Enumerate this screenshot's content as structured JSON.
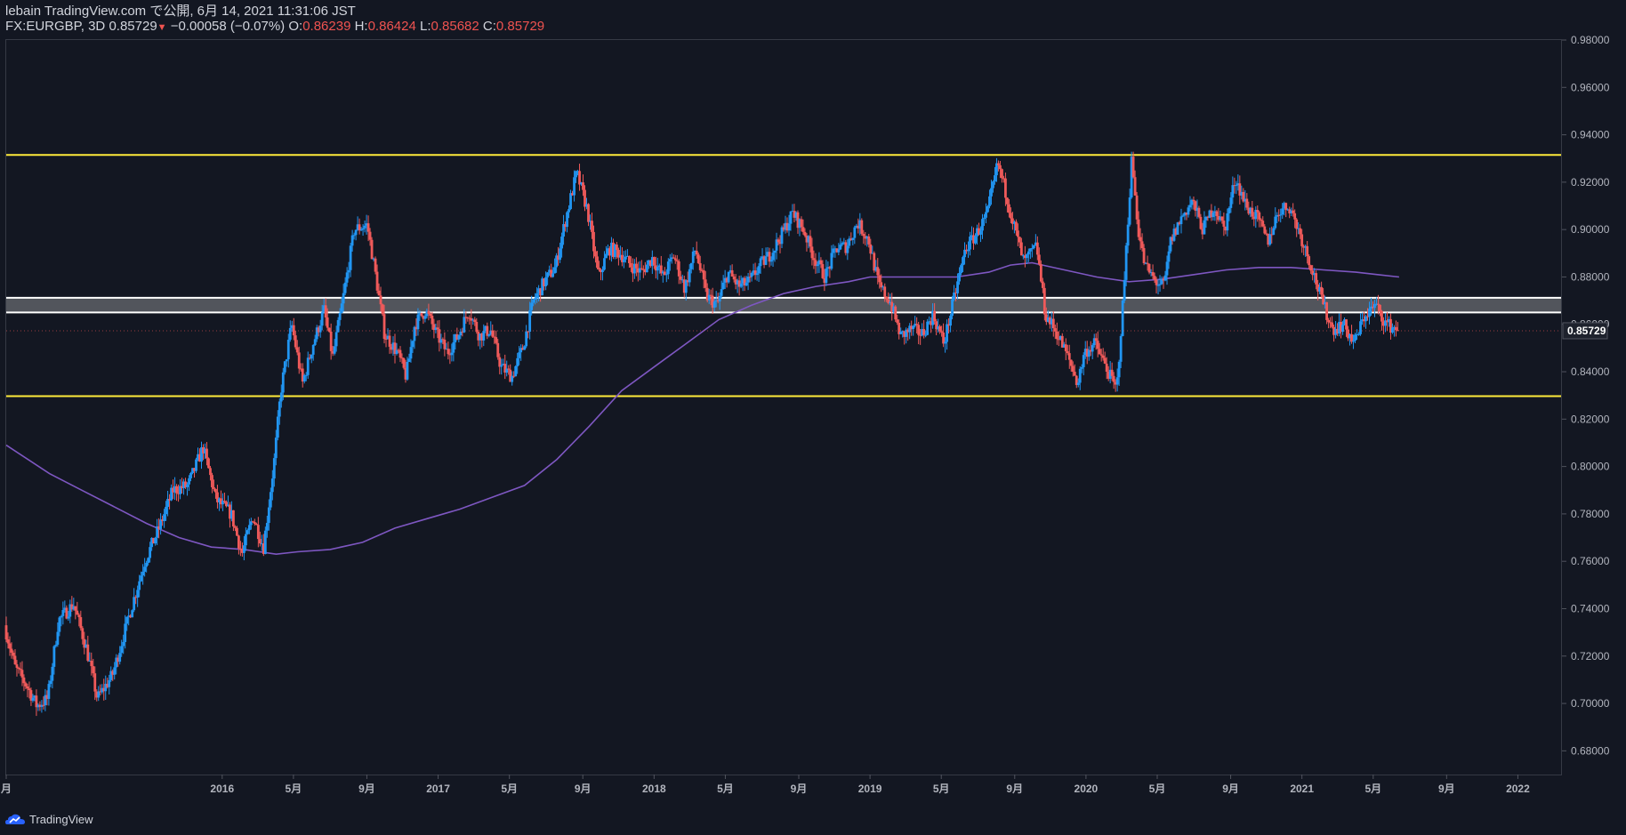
{
  "header": {
    "line1": "lebain TradingView.com で公開, 6月 14, 2021 11:31:06 JST",
    "symbol": "FX:EURGBP, 3D",
    "last": "0.85729",
    "arrow": "▼",
    "change": "−0.00058 (−0.07%)",
    "o_label": "O:",
    "o_val": "0.86239",
    "h_label": "H:",
    "h_val": "0.86424",
    "l_label": "L:",
    "l_val": "0.85682",
    "c_label": "C:",
    "c_val": "0.85729"
  },
  "footer": {
    "brand": "TradingView"
  },
  "chart_data": {
    "type": "candlestick",
    "symbol": "FX:EURGBP",
    "interval": "3D",
    "ylim": [
      0.67,
      0.98
    ],
    "y_ticks": [
      "0.98000",
      "0.96000",
      "0.94000",
      "0.92000",
      "0.90000",
      "0.88000",
      "0.86000",
      "0.84000",
      "0.82000",
      "0.80000",
      "0.78000",
      "0.76000",
      "0.74000",
      "0.72000",
      "0.70000",
      "0.68000"
    ],
    "x_ticks": [
      {
        "label": "月",
        "t": 2015.0
      },
      {
        "label": "2016",
        "t": 2016.0
      },
      {
        "label": "5月",
        "t": 2016.33
      },
      {
        "label": "9月",
        "t": 2016.67
      },
      {
        "label": "2017",
        "t": 2017.0
      },
      {
        "label": "5月",
        "t": 2017.33
      },
      {
        "label": "9月",
        "t": 2017.67
      },
      {
        "label": "2018",
        "t": 2018.0
      },
      {
        "label": "5月",
        "t": 2018.33
      },
      {
        "label": "9月",
        "t": 2018.67
      },
      {
        "label": "2019",
        "t": 2019.0
      },
      {
        "label": "5月",
        "t": 2019.33
      },
      {
        "label": "9月",
        "t": 2019.67
      },
      {
        "label": "2020",
        "t": 2020.0
      },
      {
        "label": "5月",
        "t": 2020.33
      },
      {
        "label": "9月",
        "t": 2020.67
      },
      {
        "label": "2021",
        "t": 2021.0
      },
      {
        "label": "5月",
        "t": 2021.33
      },
      {
        "label": "9月",
        "t": 2021.67
      },
      {
        "label": "2022",
        "t": 2022.0
      }
    ],
    "x_range": [
      2015.0,
      2022.2
    ],
    "last_price": 0.85729,
    "last_price_label": "0.85729",
    "horizontal_lines": [
      {
        "value": 0.9315,
        "color": "#ffeb3b"
      },
      {
        "value": 0.8297,
        "color": "#ffeb3b"
      },
      {
        "value": 0.8712,
        "color": "#ffffff"
      },
      {
        "value": 0.865,
        "color": "#ffffff"
      }
    ],
    "zone": {
      "from": 0.865,
      "to": 0.8712,
      "color": "rgba(200,200,200,0.35)"
    },
    "price_path": [
      [
        2015.0,
        0.733
      ],
      [
        2015.05,
        0.715
      ],
      [
        2015.1,
        0.708
      ],
      [
        2015.15,
        0.699
      ],
      [
        2015.2,
        0.702
      ],
      [
        2015.25,
        0.735
      ],
      [
        2015.32,
        0.742
      ],
      [
        2015.38,
        0.723
      ],
      [
        2015.43,
        0.702
      ],
      [
        2015.5,
        0.712
      ],
      [
        2015.58,
        0.738
      ],
      [
        2015.65,
        0.76
      ],
      [
        2015.72,
        0.775
      ],
      [
        2015.78,
        0.79
      ],
      [
        2015.85,
        0.792
      ],
      [
        2015.92,
        0.808
      ],
      [
        2015.98,
        0.786
      ],
      [
        2016.05,
        0.78
      ],
      [
        2016.1,
        0.763
      ],
      [
        2016.15,
        0.779
      ],
      [
        2016.2,
        0.766
      ],
      [
        2016.25,
        0.803
      ],
      [
        2016.28,
        0.832
      ],
      [
        2016.33,
        0.86
      ],
      [
        2016.38,
        0.835
      ],
      [
        2016.43,
        0.852
      ],
      [
        2016.48,
        0.866
      ],
      [
        2016.52,
        0.846
      ],
      [
        2016.57,
        0.872
      ],
      [
        2016.62,
        0.9
      ],
      [
        2016.68,
        0.902
      ],
      [
        2016.72,
        0.88
      ],
      [
        2016.76,
        0.856
      ],
      [
        2016.82,
        0.848
      ],
      [
        2016.86,
        0.838
      ],
      [
        2016.9,
        0.86
      ],
      [
        2016.95,
        0.866
      ],
      [
        2017.0,
        0.856
      ],
      [
        2017.05,
        0.848
      ],
      [
        2017.1,
        0.855
      ],
      [
        2017.15,
        0.866
      ],
      [
        2017.2,
        0.855
      ],
      [
        2017.25,
        0.858
      ],
      [
        2017.3,
        0.842
      ],
      [
        2017.35,
        0.838
      ],
      [
        2017.4,
        0.85
      ],
      [
        2017.45,
        0.87
      ],
      [
        2017.5,
        0.878
      ],
      [
        2017.55,
        0.884
      ],
      [
        2017.6,
        0.905
      ],
      [
        2017.65,
        0.924
      ],
      [
        2017.7,
        0.908
      ],
      [
        2017.75,
        0.88
      ],
      [
        2017.8,
        0.892
      ],
      [
        2017.85,
        0.89
      ],
      [
        2017.9,
        0.885
      ],
      [
        2017.95,
        0.882
      ],
      [
        2018.0,
        0.888
      ],
      [
        2018.05,
        0.88
      ],
      [
        2018.1,
        0.889
      ],
      [
        2018.15,
        0.875
      ],
      [
        2018.2,
        0.892
      ],
      [
        2018.25,
        0.872
      ],
      [
        2018.3,
        0.868
      ],
      [
        2018.35,
        0.882
      ],
      [
        2018.4,
        0.876
      ],
      [
        2018.45,
        0.878
      ],
      [
        2018.5,
        0.885
      ],
      [
        2018.55,
        0.89
      ],
      [
        2018.6,
        0.898
      ],
      [
        2018.65,
        0.907
      ],
      [
        2018.7,
        0.9
      ],
      [
        2018.75,
        0.888
      ],
      [
        2018.8,
        0.88
      ],
      [
        2018.85,
        0.892
      ],
      [
        2018.9,
        0.893
      ],
      [
        2018.95,
        0.903
      ],
      [
        2019.0,
        0.896
      ],
      [
        2019.05,
        0.876
      ],
      [
        2019.1,
        0.87
      ],
      [
        2019.15,
        0.855
      ],
      [
        2019.2,
        0.858
      ],
      [
        2019.25,
        0.856
      ],
      [
        2019.3,
        0.864
      ],
      [
        2019.35,
        0.852
      ],
      [
        2019.4,
        0.872
      ],
      [
        2019.45,
        0.892
      ],
      [
        2019.5,
        0.898
      ],
      [
        2019.55,
        0.906
      ],
      [
        2019.6,
        0.928
      ],
      [
        2019.63,
        0.918
      ],
      [
        2019.68,
        0.9
      ],
      [
        2019.72,
        0.886
      ],
      [
        2019.78,
        0.893
      ],
      [
        2019.82,
        0.864
      ],
      [
        2019.87,
        0.857
      ],
      [
        2019.93,
        0.845
      ],
      [
        2019.97,
        0.835
      ],
      [
        2020.0,
        0.848
      ],
      [
        2020.05,
        0.852
      ],
      [
        2020.1,
        0.842
      ],
      [
        2020.15,
        0.832
      ],
      [
        2020.18,
        0.87
      ],
      [
        2020.22,
        0.93
      ],
      [
        2020.25,
        0.9
      ],
      [
        2020.28,
        0.885
      ],
      [
        2020.33,
        0.878
      ],
      [
        2020.37,
        0.876
      ],
      [
        2020.4,
        0.895
      ],
      [
        2020.45,
        0.905
      ],
      [
        2020.5,
        0.912
      ],
      [
        2020.55,
        0.9
      ],
      [
        2020.6,
        0.91
      ],
      [
        2020.65,
        0.9
      ],
      [
        2020.7,
        0.922
      ],
      [
        2020.75,
        0.91
      ],
      [
        2020.8,
        0.905
      ],
      [
        2020.85,
        0.895
      ],
      [
        2020.9,
        0.908
      ],
      [
        2020.95,
        0.91
      ],
      [
        2021.0,
        0.898
      ],
      [
        2021.05,
        0.885
      ],
      [
        2021.1,
        0.87
      ],
      [
        2021.15,
        0.858
      ],
      [
        2021.2,
        0.86
      ],
      [
        2021.25,
        0.852
      ],
      [
        2021.3,
        0.864
      ],
      [
        2021.35,
        0.868
      ],
      [
        2021.4,
        0.86
      ],
      [
        2021.45,
        0.858
      ]
    ],
    "ma_path": [
      [
        2015.0,
        0.809
      ],
      [
        2015.1,
        0.803
      ],
      [
        2015.2,
        0.797
      ],
      [
        2015.35,
        0.79
      ],
      [
        2015.5,
        0.783
      ],
      [
        2015.65,
        0.776
      ],
      [
        2015.8,
        0.77
      ],
      [
        2015.95,
        0.766
      ],
      [
        2016.1,
        0.765
      ],
      [
        2016.25,
        0.763
      ],
      [
        2016.35,
        0.764
      ],
      [
        2016.5,
        0.765
      ],
      [
        2016.65,
        0.768
      ],
      [
        2016.8,
        0.774
      ],
      [
        2016.95,
        0.778
      ],
      [
        2017.1,
        0.782
      ],
      [
        2017.25,
        0.787
      ],
      [
        2017.4,
        0.792
      ],
      [
        2017.55,
        0.803
      ],
      [
        2017.7,
        0.817
      ],
      [
        2017.85,
        0.832
      ],
      [
        2018.0,
        0.842
      ],
      [
        2018.15,
        0.852
      ],
      [
        2018.3,
        0.862
      ],
      [
        2018.45,
        0.868
      ],
      [
        2018.6,
        0.873
      ],
      [
        2018.75,
        0.876
      ],
      [
        2018.9,
        0.878
      ],
      [
        2019.0,
        0.88
      ],
      [
        2019.2,
        0.88
      ],
      [
        2019.4,
        0.88
      ],
      [
        2019.55,
        0.882
      ],
      [
        2019.65,
        0.885
      ],
      [
        2019.75,
        0.886
      ],
      [
        2019.9,
        0.883
      ],
      [
        2020.05,
        0.88
      ],
      [
        2020.2,
        0.878
      ],
      [
        2020.35,
        0.879
      ],
      [
        2020.5,
        0.881
      ],
      [
        2020.65,
        0.883
      ],
      [
        2020.8,
        0.884
      ],
      [
        2020.95,
        0.884
      ],
      [
        2021.1,
        0.883
      ],
      [
        2021.25,
        0.882
      ],
      [
        2021.35,
        0.881
      ],
      [
        2021.45,
        0.88
      ]
    ],
    "colors": {
      "up": "#2196f3",
      "down": "#f05a5a",
      "ma": "#7e57c2",
      "grid": "#1e222d",
      "axis_text": "#b2b5be",
      "bg": "#131722"
    }
  }
}
